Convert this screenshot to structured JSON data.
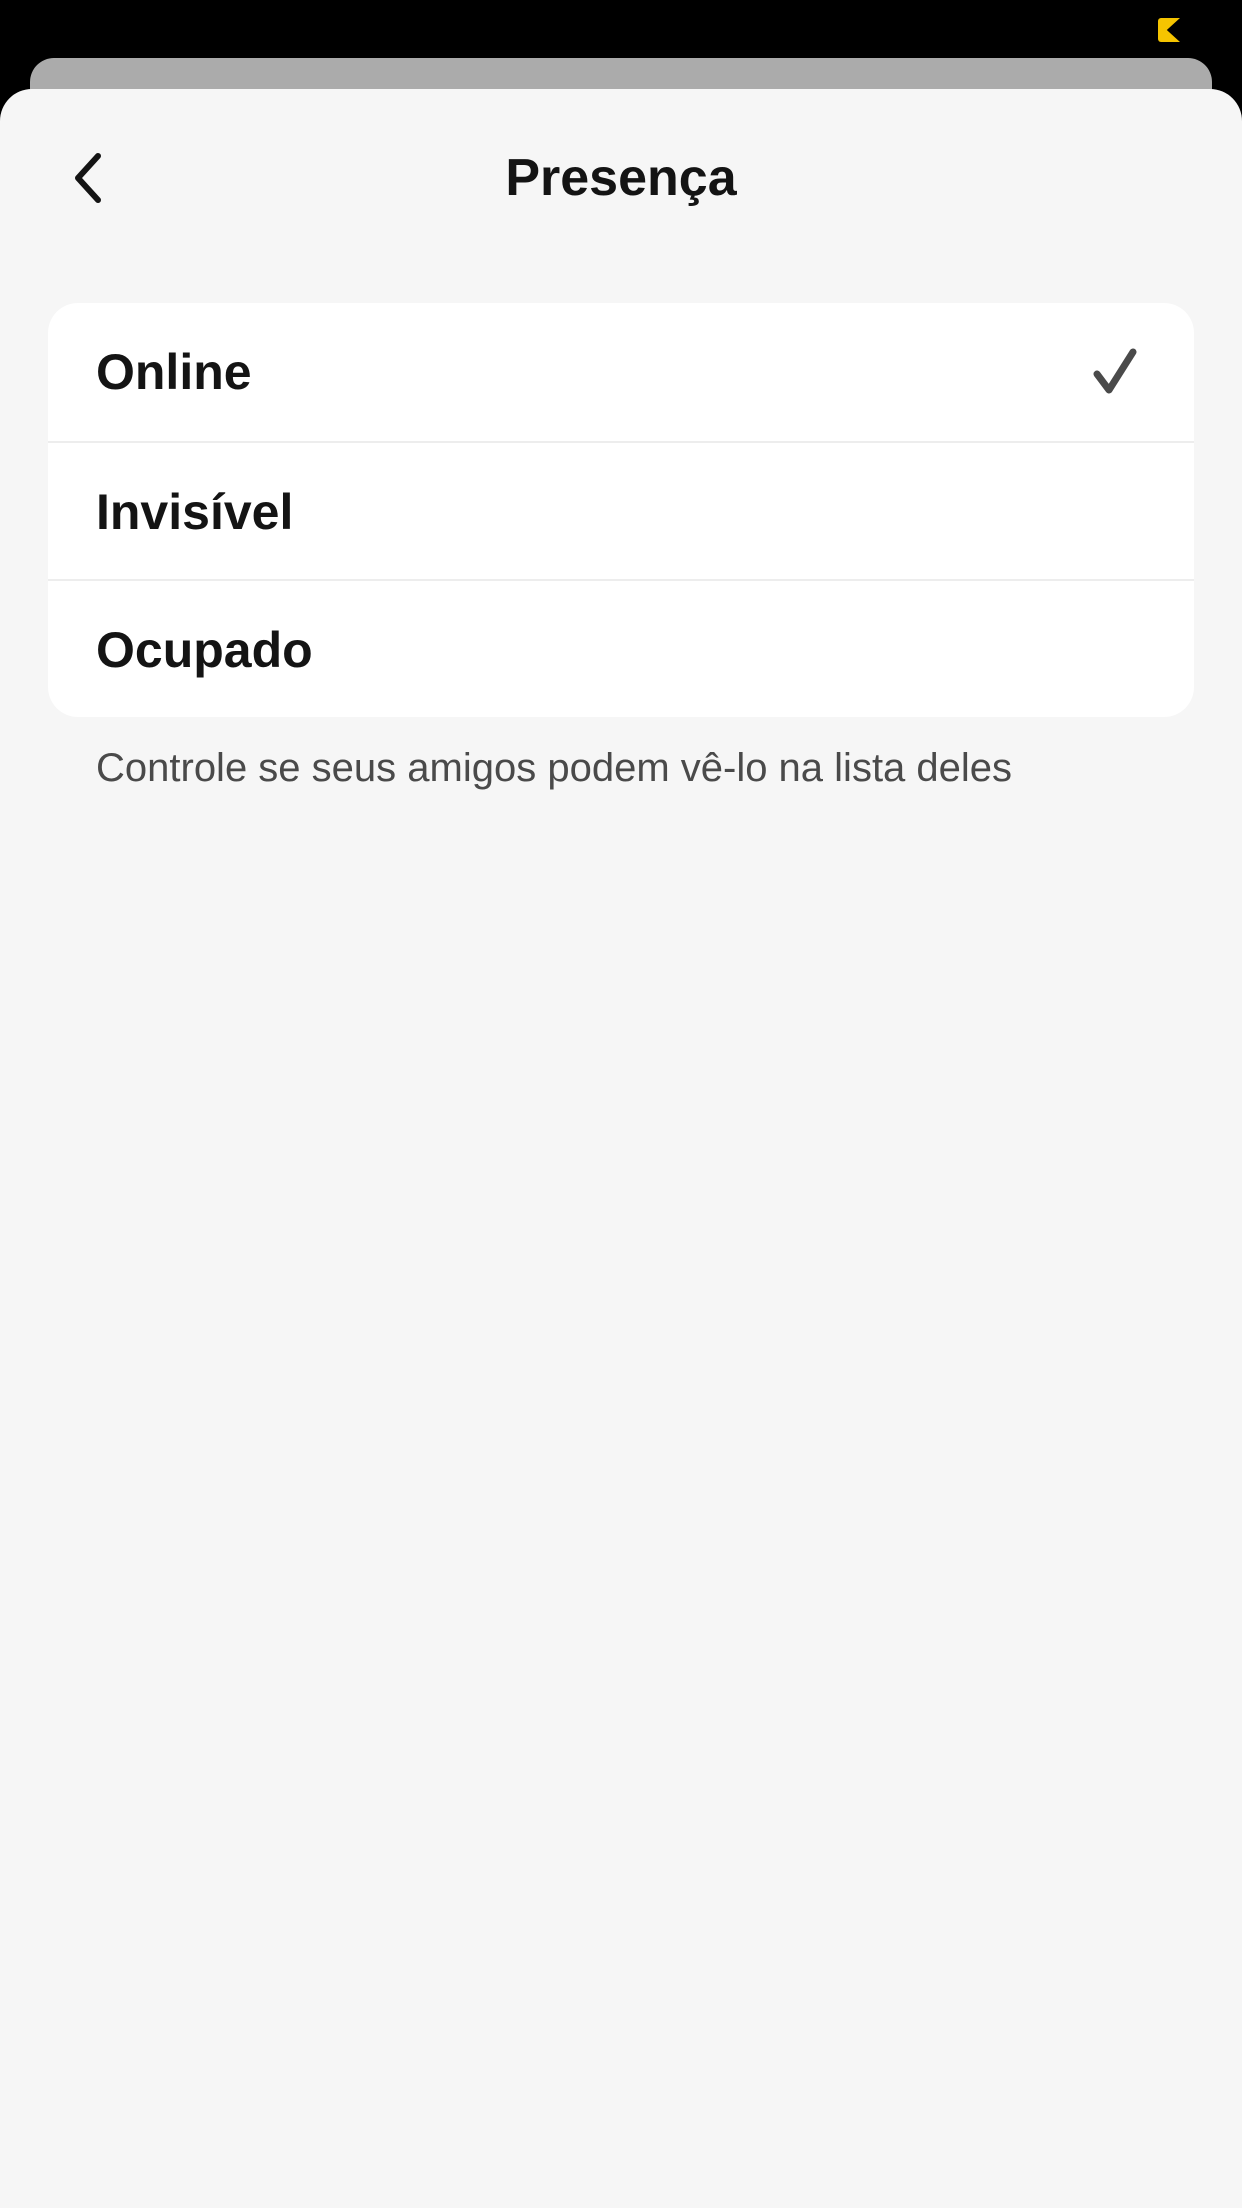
{
  "header": {
    "title": "Presença",
    "back_icon": "chevron-left-icon"
  },
  "presence": {
    "selected": "Online",
    "options": [
      {
        "label": "Online",
        "selected": true
      },
      {
        "label": "Invisível",
        "selected": false
      },
      {
        "label": "Ocupado",
        "selected": false
      }
    ],
    "helper_text": "Controle se seus amigos podem vê-lo na lista deles"
  },
  "colors": {
    "sheet_background": "#F6F6F6",
    "card_background": "#FFFFFF",
    "status_indicator": "#F5C400",
    "text_primary": "#141414",
    "text_secondary": "#4A4A4A",
    "check": "#4A4A4A"
  },
  "icons": {
    "check": "check-icon",
    "status": "status-indicator-icon"
  }
}
